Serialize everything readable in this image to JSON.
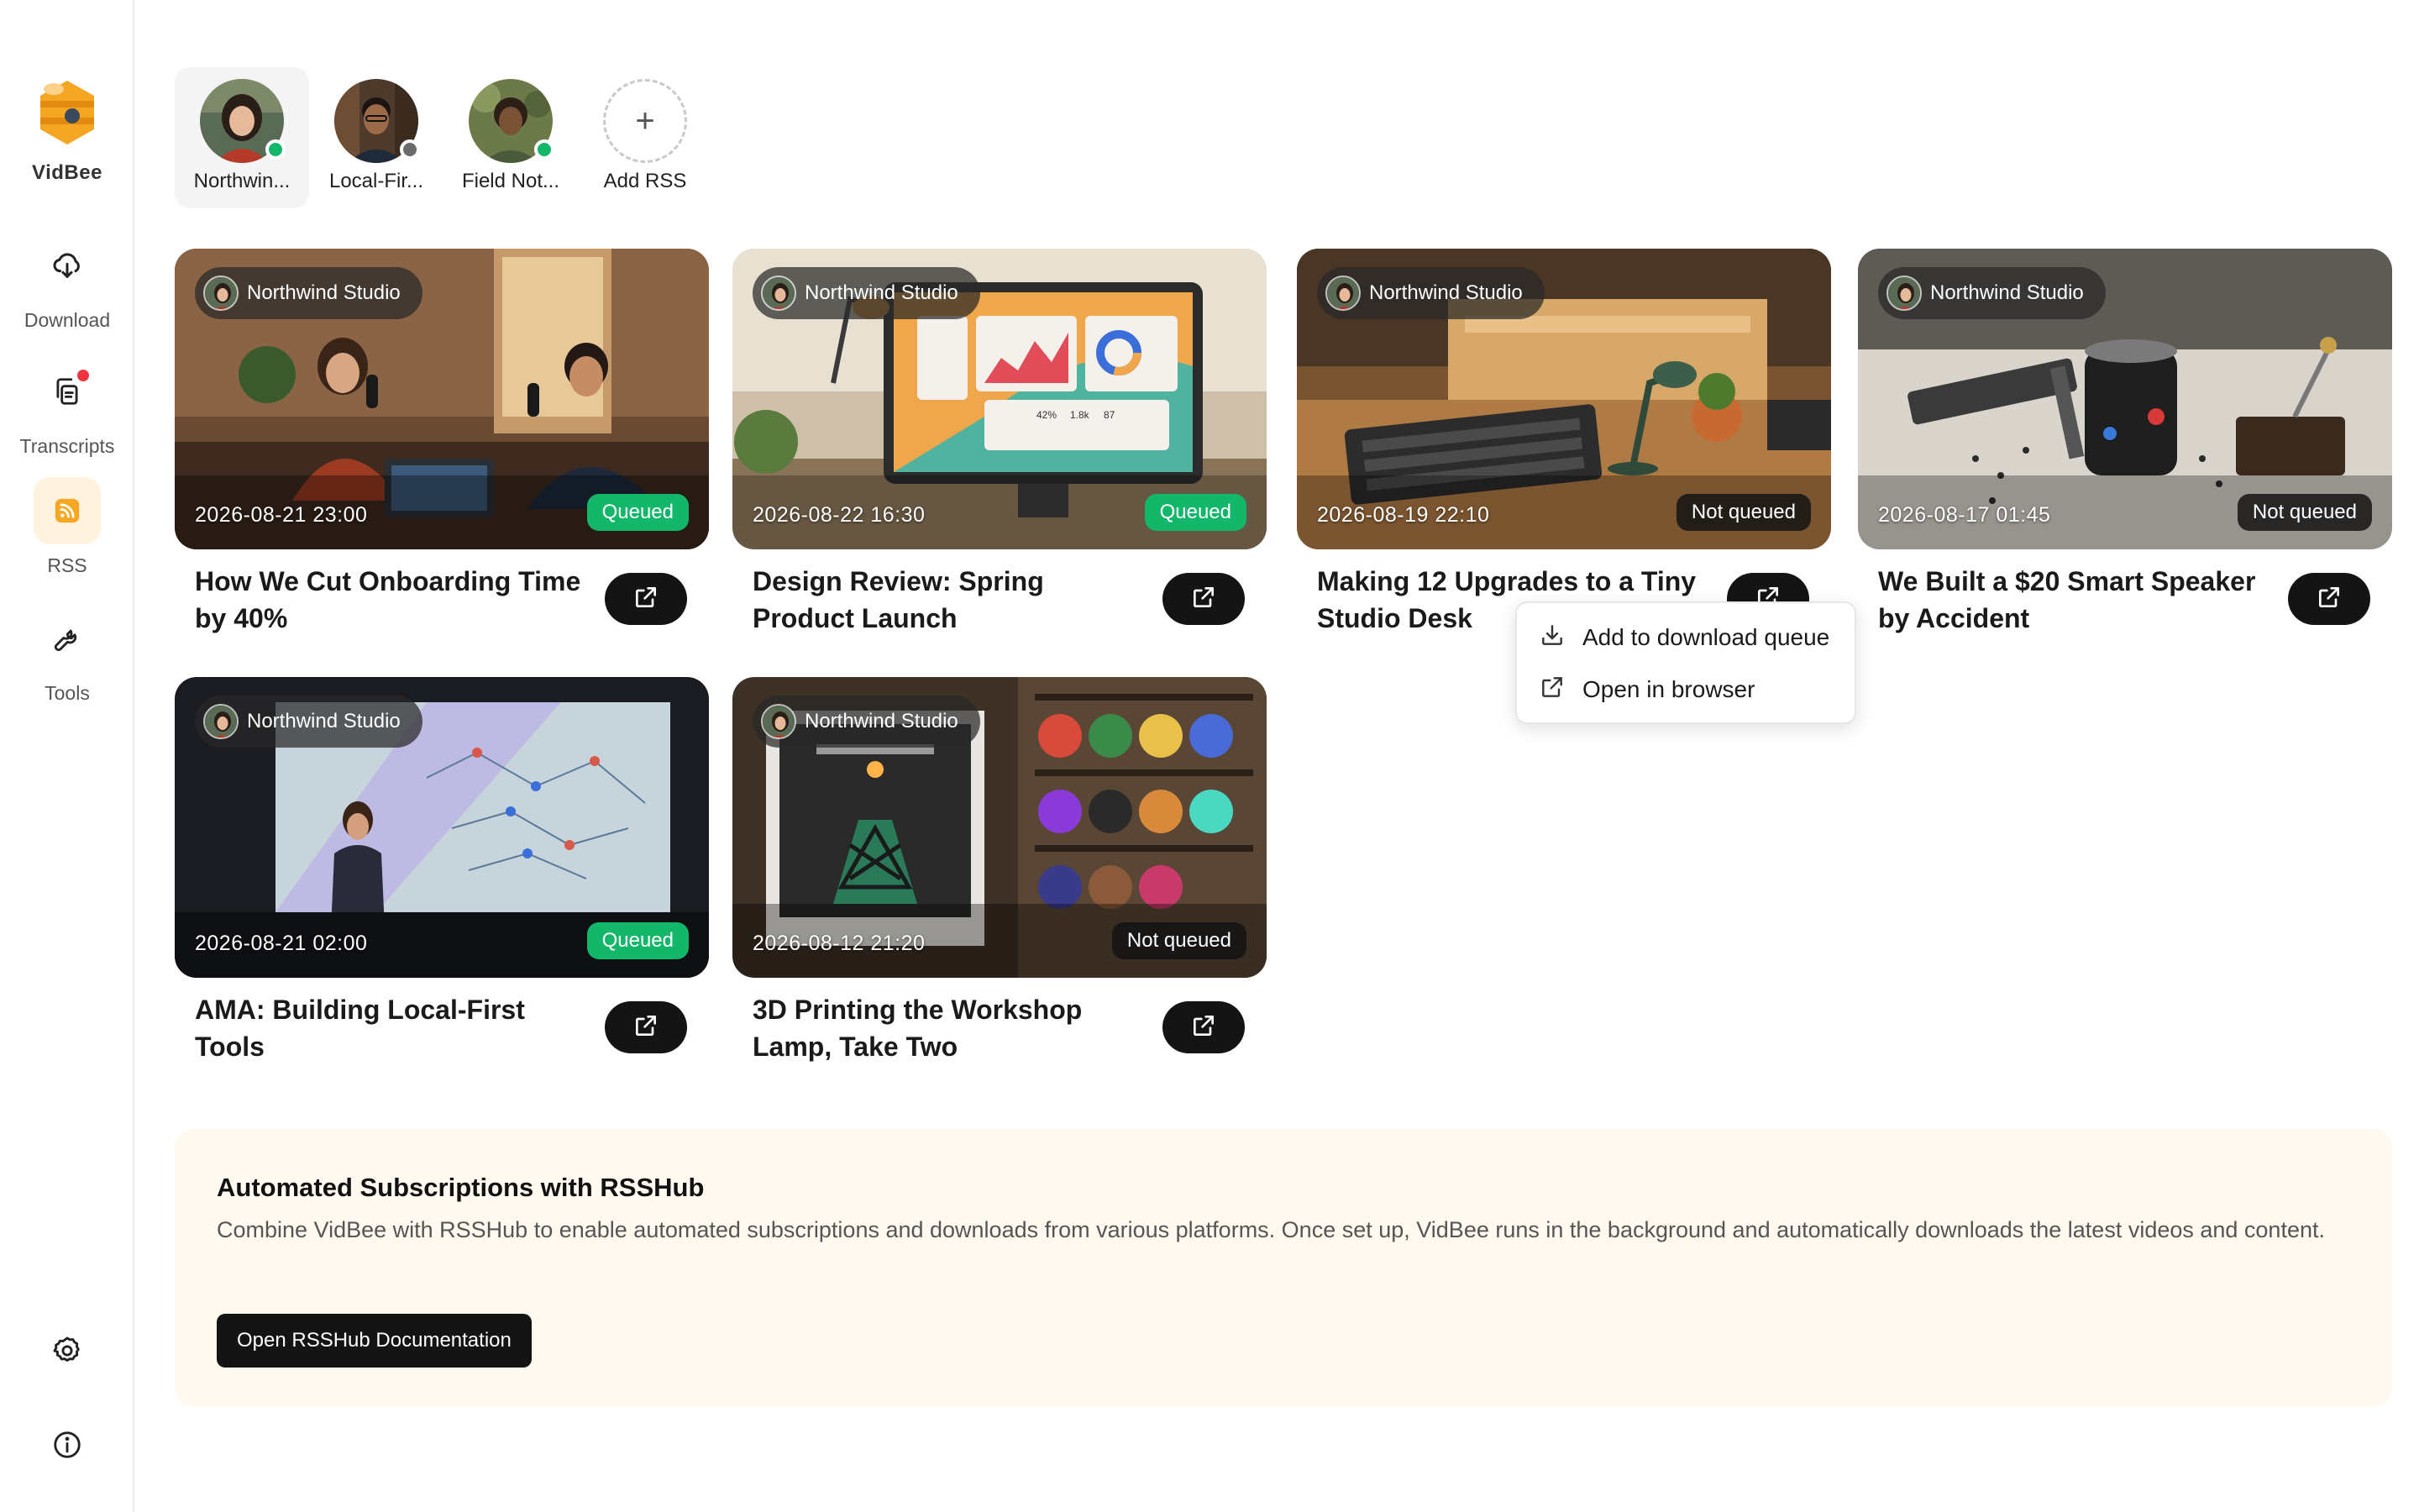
{
  "app": {
    "name": "VidBee"
  },
  "sidebar": {
    "items": [
      {
        "label": "Download",
        "icon": "cloud-download-icon"
      },
      {
        "label": "Transcripts",
        "icon": "document-copy-icon",
        "has_notification": true
      },
      {
        "label": "RSS",
        "icon": "rss-icon",
        "active": true
      },
      {
        "label": "Tools",
        "icon": "wrench-icon"
      }
    ],
    "bottom": [
      {
        "icon": "settings-gear-icon"
      },
      {
        "icon": "info-icon"
      }
    ]
  },
  "subscriptions": [
    {
      "label": "Northwin...",
      "status": "online",
      "active": true
    },
    {
      "label": "Local-Fir...",
      "status": "offline"
    },
    {
      "label": "Field Not...",
      "status": "online"
    },
    {
      "label": "Add RSS",
      "is_add": true
    }
  ],
  "colors": {
    "queued": "#12b76a",
    "online": "#12b76a",
    "offline": "#6b6b6b",
    "accent": "#f5a623",
    "notification": "#ef3340"
  },
  "videos": [
    {
      "channel": "Northwind Studio",
      "date": "2026-08-21 23:00",
      "status": "Queued",
      "title": "How We Cut Onboarding Time by 40%"
    },
    {
      "channel": "Northwind Studio",
      "date": "2026-08-22 16:30",
      "status": "Queued",
      "title": "Design Review: Spring Product Launch"
    },
    {
      "channel": "Northwind Studio",
      "date": "2026-08-19 22:10",
      "status": "Not queued",
      "title": "Making 12 Upgrades to a Tiny Studio Desk"
    },
    {
      "channel": "Northwind Studio",
      "date": "2026-08-17 01:45",
      "status": "Not queued",
      "title": "We Built a $20 Smart Speaker by Accident"
    },
    {
      "channel": "Northwind Studio",
      "date": "2026-08-21 02:00",
      "status": "Queued",
      "title": "AMA: Building Local-First Tools"
    },
    {
      "channel": "Northwind Studio",
      "date": "2026-08-12 21:20",
      "status": "Not queued",
      "title": "3D Printing the Workshop Lamp, Take Two"
    }
  ],
  "thumb_text": {
    "chart1": "42%",
    "chart2": "1.8k",
    "chart3": "87"
  },
  "context_menu": {
    "items": [
      {
        "label": "Add to download queue",
        "icon": "download-tray-icon"
      },
      {
        "label": "Open in browser",
        "icon": "external-link-icon"
      }
    ]
  },
  "rsshub": {
    "title": "Automated Subscriptions with RSSHub",
    "description": "Combine VidBee with RSSHub to enable automated subscriptions and downloads from various platforms. Once set up, VidBee runs in the background and automatically downloads the latest videos and content.",
    "button_label": "Open RSSHub Documentation"
  }
}
